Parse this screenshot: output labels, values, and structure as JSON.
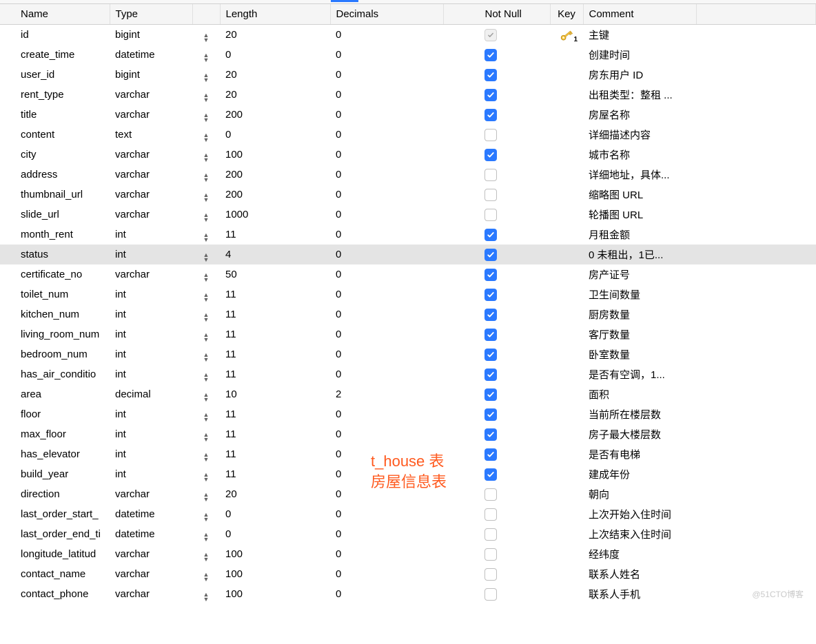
{
  "headers": {
    "name": "Name",
    "type": "Type",
    "length": "Length",
    "decimals": "Decimals",
    "not_null": "Not Null",
    "key": "Key",
    "comment": "Comment"
  },
  "annotation": {
    "line1": "t_house 表",
    "line2": "房屋信息表"
  },
  "watermark": "@51CTO博客",
  "rows": [
    {
      "name": "id",
      "type": "bigint",
      "length": "20",
      "decimals": "0",
      "not_null": "disabled-checked",
      "key": true,
      "comment": "主键",
      "selected": false
    },
    {
      "name": "create_time",
      "type": "datetime",
      "length": "0",
      "decimals": "0",
      "not_null": "checked",
      "key": false,
      "comment": "创建时间",
      "selected": false
    },
    {
      "name": "user_id",
      "type": "bigint",
      "length": "20",
      "decimals": "0",
      "not_null": "checked",
      "key": false,
      "comment": "房东用户 ID",
      "selected": false
    },
    {
      "name": "rent_type",
      "type": "varchar",
      "length": "20",
      "decimals": "0",
      "not_null": "checked",
      "key": false,
      "comment": "出租类型：整租 ...",
      "selected": false
    },
    {
      "name": "title",
      "type": "varchar",
      "length": "200",
      "decimals": "0",
      "not_null": "checked",
      "key": false,
      "comment": "房屋名称",
      "selected": false
    },
    {
      "name": "content",
      "type": "text",
      "length": "0",
      "decimals": "0",
      "not_null": "unchecked",
      "key": false,
      "comment": "详细描述内容",
      "selected": false
    },
    {
      "name": "city",
      "type": "varchar",
      "length": "100",
      "decimals": "0",
      "not_null": "checked",
      "key": false,
      "comment": "城市名称",
      "selected": false
    },
    {
      "name": "address",
      "type": "varchar",
      "length": "200",
      "decimals": "0",
      "not_null": "unchecked",
      "key": false,
      "comment": "详细地址，具体...",
      "selected": false
    },
    {
      "name": "thumbnail_url",
      "type": "varchar",
      "length": "200",
      "decimals": "0",
      "not_null": "unchecked",
      "key": false,
      "comment": "缩略图 URL",
      "selected": false
    },
    {
      "name": "slide_url",
      "type": "varchar",
      "length": "1000",
      "decimals": "0",
      "not_null": "unchecked",
      "key": false,
      "comment": "轮播图 URL",
      "selected": false
    },
    {
      "name": "month_rent",
      "type": "int",
      "length": "11",
      "decimals": "0",
      "not_null": "checked",
      "key": false,
      "comment": "月租金额",
      "selected": false
    },
    {
      "name": "status",
      "type": "int",
      "length": "4",
      "decimals": "0",
      "not_null": "checked",
      "key": false,
      "comment": "0 未租出，1已...",
      "selected": true
    },
    {
      "name": "certificate_no",
      "type": "varchar",
      "length": "50",
      "decimals": "0",
      "not_null": "checked",
      "key": false,
      "comment": "房产证号",
      "selected": false
    },
    {
      "name": "toilet_num",
      "type": "int",
      "length": "11",
      "decimals": "0",
      "not_null": "checked",
      "key": false,
      "comment": "卫生间数量",
      "selected": false
    },
    {
      "name": "kitchen_num",
      "type": "int",
      "length": "11",
      "decimals": "0",
      "not_null": "checked",
      "key": false,
      "comment": "厨房数量",
      "selected": false
    },
    {
      "name": "living_room_num",
      "type": "int",
      "length": "11",
      "decimals": "0",
      "not_null": "checked",
      "key": false,
      "comment": "客厅数量",
      "selected": false
    },
    {
      "name": "bedroom_num",
      "type": "int",
      "length": "11",
      "decimals": "0",
      "not_null": "checked",
      "key": false,
      "comment": "卧室数量",
      "selected": false
    },
    {
      "name": "has_air_conditio",
      "type": "int",
      "length": "11",
      "decimals": "0",
      "not_null": "checked",
      "key": false,
      "comment": "是否有空调，1...",
      "selected": false
    },
    {
      "name": "area",
      "type": "decimal",
      "length": "10",
      "decimals": "2",
      "not_null": "checked",
      "key": false,
      "comment": "面积",
      "selected": false
    },
    {
      "name": "floor",
      "type": "int",
      "length": "11",
      "decimals": "0",
      "not_null": "checked",
      "key": false,
      "comment": "当前所在楼层数",
      "selected": false
    },
    {
      "name": "max_floor",
      "type": "int",
      "length": "11",
      "decimals": "0",
      "not_null": "checked",
      "key": false,
      "comment": "房子最大楼层数",
      "selected": false
    },
    {
      "name": "has_elevator",
      "type": "int",
      "length": "11",
      "decimals": "0",
      "not_null": "checked",
      "key": false,
      "comment": "是否有电梯",
      "selected": false
    },
    {
      "name": "build_year",
      "type": "int",
      "length": "11",
      "decimals": "0",
      "not_null": "checked",
      "key": false,
      "comment": "建成年份",
      "selected": false
    },
    {
      "name": "direction",
      "type": "varchar",
      "length": "20",
      "decimals": "0",
      "not_null": "unchecked",
      "key": false,
      "comment": "朝向",
      "selected": false
    },
    {
      "name": "last_order_start_",
      "type": "datetime",
      "length": "0",
      "decimals": "0",
      "not_null": "unchecked",
      "key": false,
      "comment": "上次开始入住时间",
      "selected": false
    },
    {
      "name": "last_order_end_ti",
      "type": "datetime",
      "length": "0",
      "decimals": "0",
      "not_null": "unchecked",
      "key": false,
      "comment": "上次结束入住时间",
      "selected": false
    },
    {
      "name": "longitude_latitud",
      "type": "varchar",
      "length": "100",
      "decimals": "0",
      "not_null": "unchecked",
      "key": false,
      "comment": "经纬度",
      "selected": false
    },
    {
      "name": "contact_name",
      "type": "varchar",
      "length": "100",
      "decimals": "0",
      "not_null": "unchecked",
      "key": false,
      "comment": "联系人姓名",
      "selected": false
    },
    {
      "name": "contact_phone",
      "type": "varchar",
      "length": "100",
      "decimals": "0",
      "not_null": "unchecked",
      "key": false,
      "comment": "联系人手机",
      "selected": false
    }
  ]
}
